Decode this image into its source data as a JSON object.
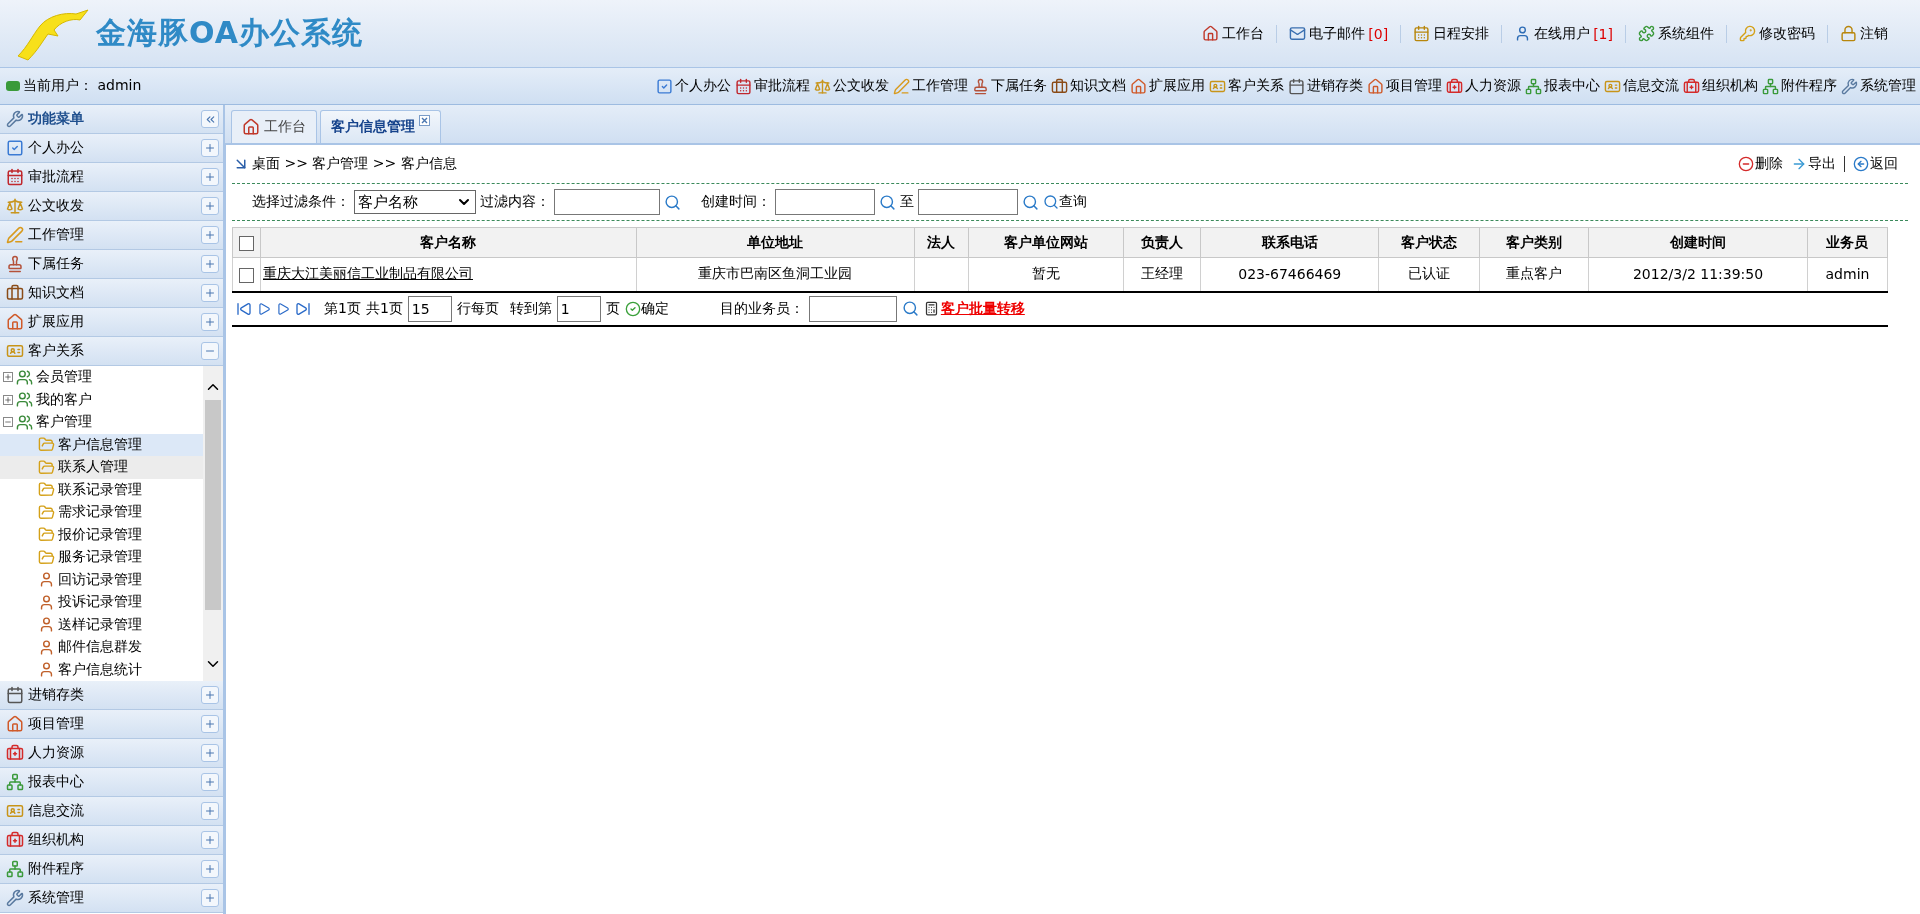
{
  "header": {
    "logo_text": "金海豚OA办公系统",
    "links": [
      {
        "label": "工作台"
      },
      {
        "label": "电子邮件",
        "count": "[0]"
      },
      {
        "label": "日程安排"
      },
      {
        "label": "在线用户",
        "count": "[1]"
      },
      {
        "label": "系统组件"
      },
      {
        "label": "修改密码"
      },
      {
        "label": "注销"
      }
    ]
  },
  "user_bar": {
    "user": "当前用户： admin",
    "modules": [
      "个人办公",
      "审批流程",
      "公文收发",
      "工作管理",
      "下属任务",
      "知识文档",
      "扩展应用",
      "客户关系",
      "进销存类",
      "项目管理",
      "人力资源",
      "报表中心",
      "信息交流",
      "组织机构",
      "附件程序",
      "系统管理"
    ]
  },
  "sidebar": {
    "title": "功能菜单",
    "groups": [
      {
        "label": "个人办公",
        "expanded": false
      },
      {
        "label": "审批流程",
        "expanded": false
      },
      {
        "label": "公文收发",
        "expanded": false
      },
      {
        "label": "工作管理",
        "expanded": false
      },
      {
        "label": "下属任务",
        "expanded": false
      },
      {
        "label": "知识文档",
        "expanded": false
      },
      {
        "label": "扩展应用",
        "expanded": false
      },
      {
        "label": "客户关系",
        "expanded": true,
        "tree": [
          {
            "label": "会员管理",
            "expanded": false
          },
          {
            "label": "我的客户",
            "expanded": false
          },
          {
            "label": "客户管理",
            "expanded": true,
            "children": [
              {
                "label": "客户信息管理",
                "kind": "folder",
                "selected": true,
                "hover": false
              },
              {
                "label": "联系人管理",
                "kind": "folder",
                "selected": false,
                "hover": true
              },
              {
                "label": "联系记录管理",
                "kind": "folder",
                "selected": false,
                "hover": false
              },
              {
                "label": "需求记录管理",
                "kind": "folder",
                "selected": false,
                "hover": false
              },
              {
                "label": "报价记录管理",
                "kind": "folder",
                "selected": false,
                "hover": false
              },
              {
                "label": "服务记录管理",
                "kind": "folder",
                "selected": false,
                "hover": false
              },
              {
                "label": "回访记录管理",
                "kind": "person",
                "selected": false,
                "hover": false
              },
              {
                "label": "投诉记录管理",
                "kind": "person",
                "selected": false,
                "hover": false
              },
              {
                "label": "送样记录管理",
                "kind": "person",
                "selected": false,
                "hover": false
              },
              {
                "label": "邮件信息群发",
                "kind": "person",
                "selected": false,
                "hover": false
              },
              {
                "label": "客户信息统计",
                "kind": "person",
                "selected": false,
                "hover": false
              }
            ]
          }
        ]
      },
      {
        "label": "进销存类",
        "expanded": false
      },
      {
        "label": "项目管理",
        "expanded": false
      },
      {
        "label": "人力资源",
        "expanded": false
      },
      {
        "label": "报表中心",
        "expanded": false
      },
      {
        "label": "信息交流",
        "expanded": false
      },
      {
        "label": "组织机构",
        "expanded": false
      },
      {
        "label": "附件程序",
        "expanded": false
      },
      {
        "label": "系统管理",
        "expanded": false
      }
    ]
  },
  "tabs": [
    {
      "label": "工作台",
      "selected": false,
      "closable": false
    },
    {
      "label": "客户信息管理",
      "selected": true,
      "closable": true
    }
  ],
  "breadcrumb": "桌面 >> 客户管理 >> 客户信息",
  "actions": [
    {
      "label": "删除",
      "kind": "delete"
    },
    {
      "label": "导出",
      "kind": "export"
    },
    {
      "label": "返回",
      "kind": "back"
    }
  ],
  "filter": {
    "condition_label": "选择过滤条件：",
    "condition_value": "客户名称",
    "content_label": "过滤内容：",
    "date_label": "创建时间：",
    "to_label": "至",
    "search": "查询"
  },
  "table": {
    "header_checked": false,
    "columns": [
      "客户名称",
      "单位地址",
      "法人",
      "客户单位网站",
      "负责人",
      "联系电话",
      "客户状态",
      "客户类别",
      "创建时间",
      "业务员"
    ],
    "rows": [
      {
        "checked": false,
        "cells": [
          "重庆大江美丽信工业制品有限公司",
          "重庆市巴南区鱼洞工业园",
          "",
          "暂无",
          "王经理",
          "023-67466469",
          "已认证",
          "重点客户",
          "2012/3/2 11:39:50",
          "admin"
        ]
      }
    ]
  },
  "pager": {
    "page": "第1页",
    "total": "共1页",
    "page_size": "15",
    "per_page": "行每页",
    "goto": "转到第",
    "goto_value": "1",
    "page_unit": "页",
    "confirm": "确定",
    "target_label": "目的业务员：",
    "transfer": "客户批量转移"
  }
}
